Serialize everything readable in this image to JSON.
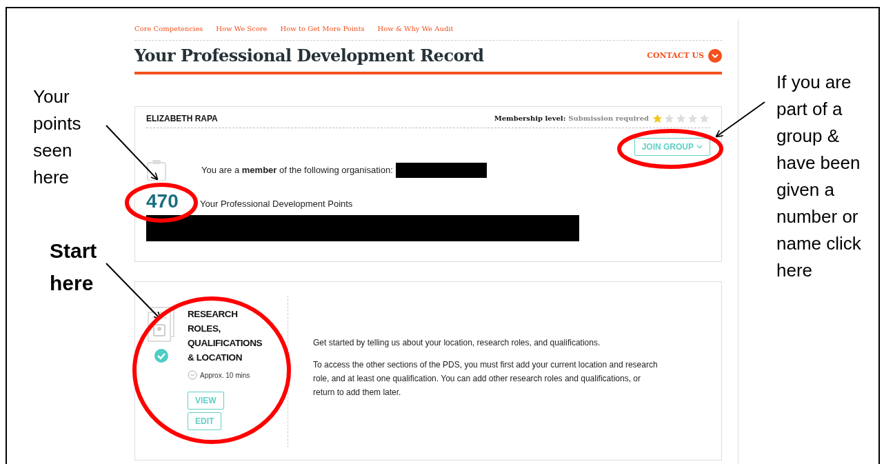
{
  "nav": [
    "Core Competencies",
    "How We Score",
    "How to Get More Points",
    "How & Why We Audit"
  ],
  "title": "Your Professional Development Record",
  "contact": "CONTACT US",
  "profile": {
    "name": "ELIZABETH RAPA",
    "membership_label": "Membership level:",
    "membership_value": "Submission required",
    "stars": 1,
    "join_button": "JOIN GROUP",
    "member_text": "You are a **member** of the following organisation:",
    "points": "470",
    "points_label": "Your Professional Development Points"
  },
  "section": {
    "title": "RESEARCH ROLES, QUALIFICATIONS & LOCATION",
    "completed": true,
    "duration": "Approx. 10 mins",
    "buttons": [
      "VIEW",
      "EDIT"
    ],
    "paragraphs": [
      "Get started by telling us about your location, research roles, and qualifications.",
      "To access the other sections of the PDS, you must first add your current location and research role, and at least one qualification. You can add other research roles and qualifications, or return to add them later."
    ]
  },
  "annotations": [
    {
      "kind": "points",
      "text": "Your points seen here"
    },
    {
      "kind": "start",
      "text": "Start here"
    },
    {
      "kind": "group",
      "text": "If you are part of a group & have been given a number or name click here"
    }
  ]
}
